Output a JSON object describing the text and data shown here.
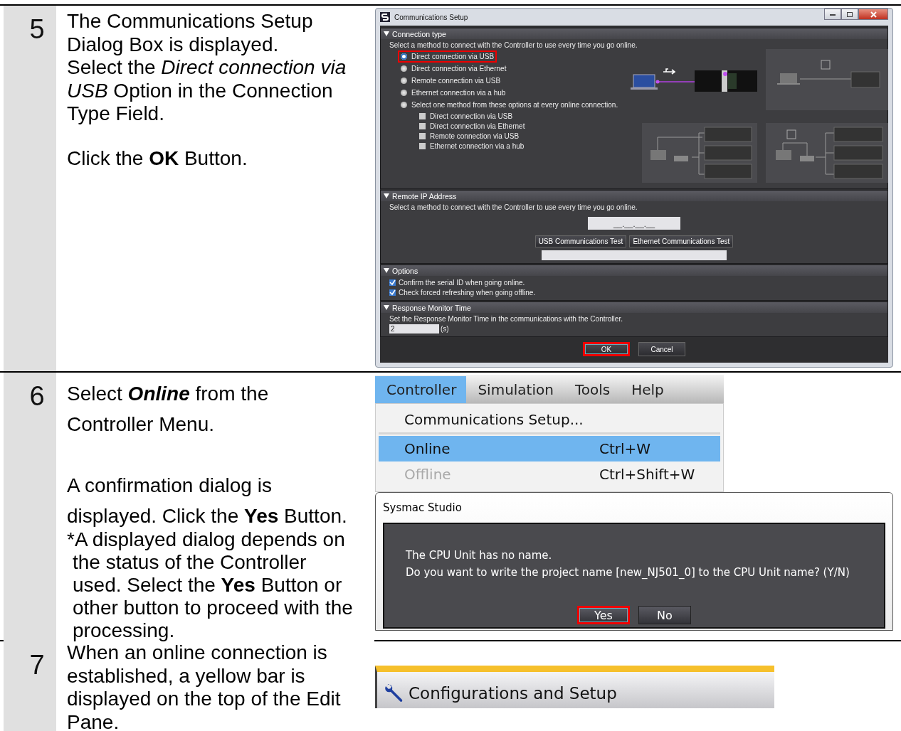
{
  "steps": [
    {
      "number": "5",
      "paragraphs": [
        {
          "kind": "text",
          "lines": [
            "The Communications Setup",
            "Dialog Box is displayed.",
            "Select the *Direct connection via*",
            "*USB* Option in the Connection",
            "Type Field."
          ]
        },
        {
          "kind": "text",
          "lines": [
            "Click the **OK** Button."
          ]
        }
      ]
    },
    {
      "number": "6",
      "paragraphs": [
        {
          "kind": "wide",
          "bold_italic": true,
          "lines": [
            "Select **Online** from the",
            "Controller Menu."
          ]
        },
        {
          "kind": "wide",
          "lines": [
            "A confirmation dialog is",
            "displayed. Click the **Yes** Button."
          ]
        },
        {
          "kind": "note",
          "lines": [
            "*A displayed dialog depends on",
            "the status of the Controller",
            "used. Select the **Yes** Button or",
            "other button to proceed with the",
            "processing."
          ]
        }
      ]
    },
    {
      "number": "7",
      "paragraphs": [
        {
          "kind": "text",
          "lines": [
            "When an online connection is",
            "established, a yellow bar is",
            "displayed on the top of the Edit",
            "Pane."
          ]
        }
      ]
    }
  ],
  "comm_setup_dialog": {
    "title": "Communications Setup",
    "connection_type": {
      "header": "Connection type",
      "hint": "Select a method to connect with the Controller to use every time you go online.",
      "options": [
        {
          "label": "Direct connection via USB",
          "selected": true,
          "highlighted": true
        },
        {
          "label": "Direct connection via Ethernet",
          "selected": false,
          "highlighted": false
        },
        {
          "label": "Remote connection via USB",
          "selected": false,
          "highlighted": false
        },
        {
          "label": "Ethernet connection via a hub",
          "selected": false,
          "highlighted": false
        },
        {
          "label": "Select one method from these options at every online connection.",
          "selected": false,
          "highlighted": false
        }
      ],
      "sub_options": [
        {
          "label": "Direct connection via USB",
          "checked": false
        },
        {
          "label": "Direct connection via Ethernet",
          "checked": false
        },
        {
          "label": "Remote connection via USB",
          "checked": false
        },
        {
          "label": "Ethernet connection via a hub",
          "checked": false
        }
      ]
    },
    "remote_ip": {
      "header": "Remote IP Address",
      "hint": "Select a method to connect with the Controller to use every time you go online.",
      "ip_value": "__.__.__.__",
      "buttons": [
        "USB Communications Test",
        "Ethernet Communications Test"
      ]
    },
    "options": {
      "header": "Options",
      "checkboxes": [
        {
          "label": "Confirm the serial ID when going online.",
          "checked": true
        },
        {
          "label": "Check forced refreshing when going offline.",
          "checked": true
        }
      ]
    },
    "response_monitor": {
      "header": "Response Monitor Time",
      "hint": "Set the Response Monitor Time in the communications with the Controller.",
      "value": "2",
      "unit": "(s)"
    },
    "buttons": [
      {
        "label": "OK",
        "highlighted": true
      },
      {
        "label": "Cancel",
        "highlighted": false
      }
    ]
  },
  "controller_menu": {
    "menubar": [
      {
        "label": "Controller",
        "selected": true
      },
      {
        "label": "Simulation",
        "selected": false
      },
      {
        "label": "Tools",
        "selected": false
      },
      {
        "label": "Help",
        "selected": false
      }
    ],
    "items": [
      {
        "label": "Communications Setup...",
        "selected": false,
        "disabled": false,
        "separator_after": true
      },
      {
        "label": "Online",
        "shortcut": "Ctrl+W",
        "selected": true,
        "disabled": false,
        "separator_after": false
      },
      {
        "label": "Offline",
        "shortcut": "Ctrl+Shift+W",
        "selected": false,
        "disabled": true,
        "separator_after": false
      }
    ]
  },
  "confirm_dialog": {
    "title": "Sysmac Studio",
    "message_lines": [
      "The CPU Unit has no name.",
      "Do you want to write the project name [new_NJ501_0] to the CPU Unit name? (Y/N)"
    ],
    "buttons": [
      {
        "label": "Yes",
        "highlighted": true
      },
      {
        "label": "No",
        "highlighted": false
      }
    ]
  },
  "edit_pane_bar": {
    "title": "Configurations and Setup",
    "online": true
  }
}
